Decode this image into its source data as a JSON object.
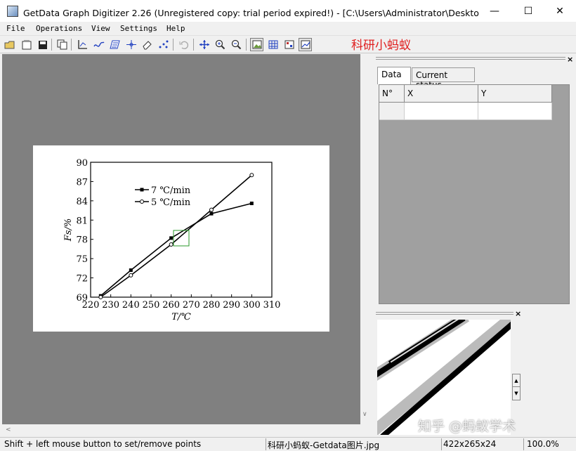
{
  "window": {
    "title": "GetData Graph Digitizer 2.26 (Unregistered copy: trial period expired!) - [C:\\Users\\Administrator\\Desktop\\科...",
    "minimize": "—",
    "maximize": "☐",
    "close": "✕"
  },
  "menu": [
    "File",
    "Operations",
    "View",
    "Settings",
    "Help"
  ],
  "toolbar_icons": [
    "open-icon",
    "open-image-icon",
    "save-icon",
    "copy-icon",
    "set-axes-icon",
    "line-digitize-icon",
    "area-digitize-icon",
    "point-capture-icon",
    "eraser-icon",
    "point-sort-icon",
    "undo-icon",
    "move-icon",
    "zoom-in-icon",
    "zoom-out-icon",
    "image-view-icon",
    "grid-icon",
    "point-mode-icon",
    "graph-view-icon"
  ],
  "watermark_top": "科研小蚂蚁",
  "right_panel": {
    "tabs": [
      "Data",
      "Current status"
    ],
    "columns": [
      "N°",
      "X",
      "Y"
    ],
    "close": "×"
  },
  "zoom_panel": {
    "close": "×"
  },
  "watermark_bottom": "知乎 @蚂蚁学术",
  "status": {
    "hint": "Shift + left mouse button to set/remove points",
    "file": "科研小蚂蚁-Getdata图片.jpg",
    "size": "422x265x24",
    "zoom": "100.0%"
  },
  "chart_data": {
    "type": "line",
    "xlabel": "T/℃",
    "ylabel": "Fs/%",
    "xlim": [
      220,
      310
    ],
    "ylim": [
      69,
      90
    ],
    "xticks": [
      220,
      230,
      240,
      250,
      260,
      270,
      280,
      290,
      300,
      310
    ],
    "yticks": [
      69,
      72,
      75,
      78,
      81,
      84,
      87,
      90
    ],
    "grid": false,
    "legend": "upper-left",
    "series": [
      {
        "name": "7 ℃/min",
        "marker": "filled-square",
        "x": [
          225,
          240,
          260,
          280,
          300
        ],
        "y": [
          69.2,
          73.2,
          78.2,
          82.0,
          83.6
        ]
      },
      {
        "name": "5 ℃/min",
        "marker": "open-circle",
        "x": [
          225,
          240,
          260,
          280,
          300
        ],
        "y": [
          69.0,
          72.4,
          77.2,
          82.6,
          88.0
        ]
      }
    ]
  }
}
